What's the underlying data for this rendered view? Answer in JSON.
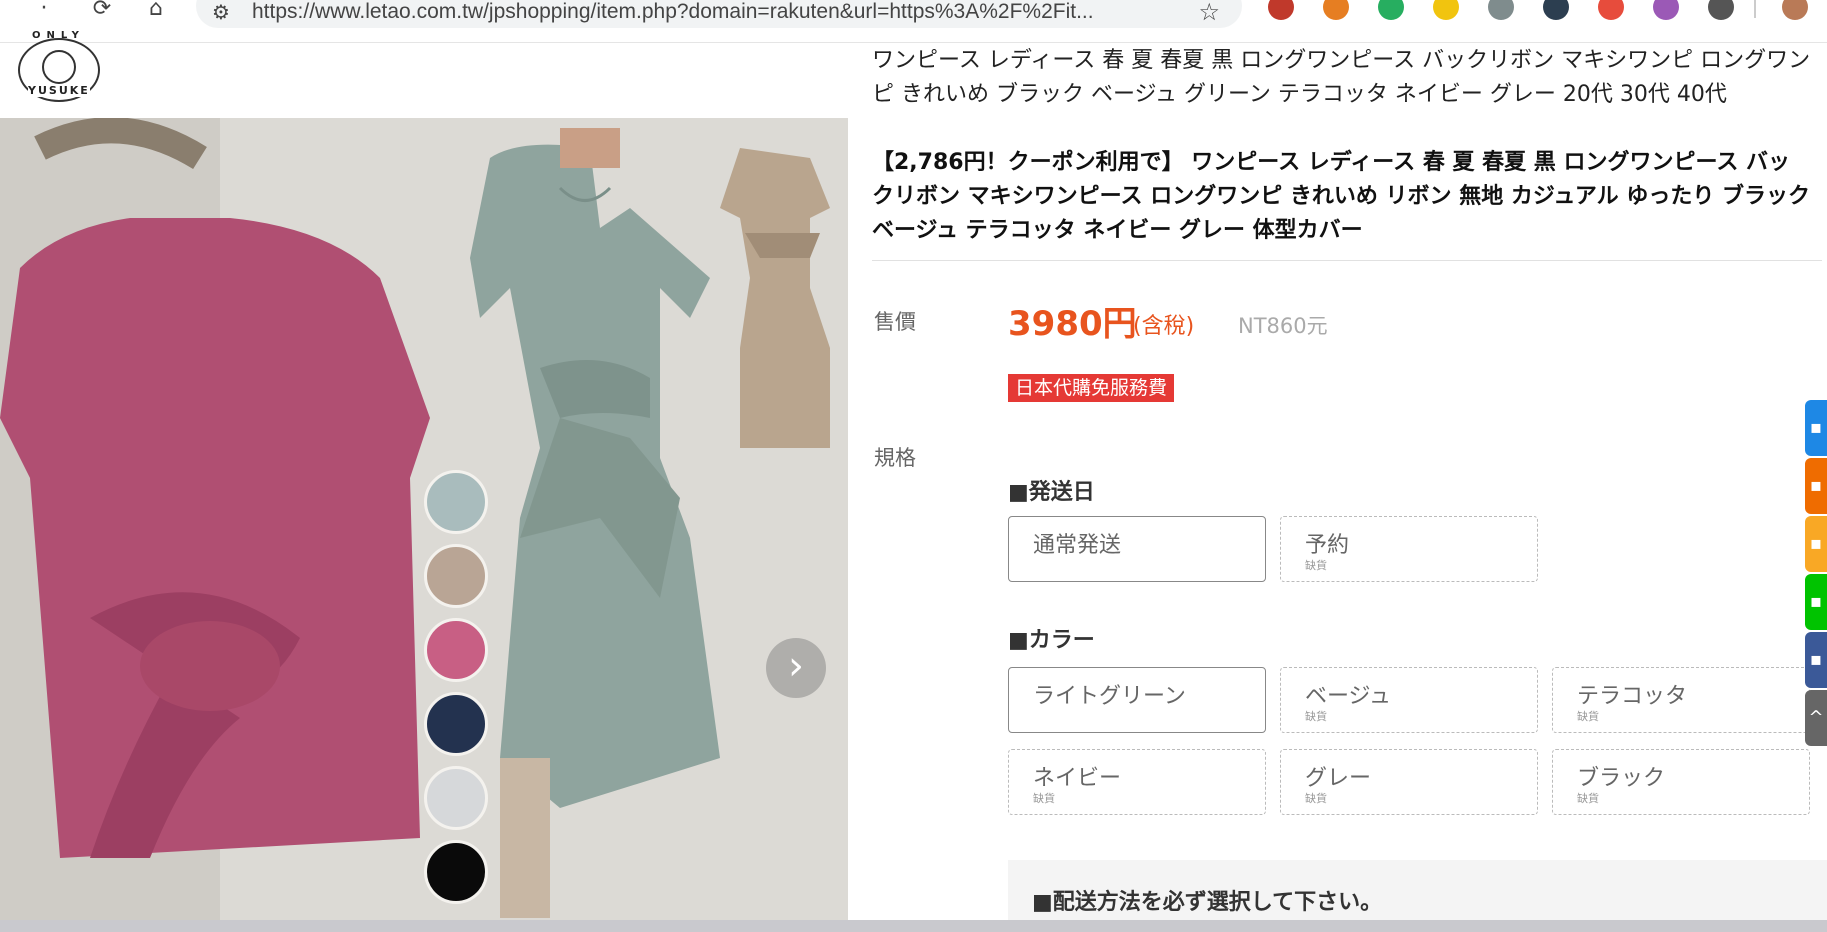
{
  "browser": {
    "url": "https://www.letao.com.tw/jpshopping/item.php?domain=rakuten&url=https%3A%2F%2Fit...",
    "ext_colors": [
      "#c0392b",
      "#e67e22",
      "#27ae60",
      "#f1c40f",
      "#7f8c8d",
      "#2c3e50",
      "#e74c3c",
      "#9b59b6",
      "#555555"
    ]
  },
  "logo": {
    "top_text": "ONLY",
    "bottom_text": "YUSUKE"
  },
  "product": {
    "title": "ワンピース レディース 春 夏 春夏 黒 ロングワンピース バックリボン マキシワンピ ロングワンピ きれいめ ブラック ベージュ グリーン テラコッタ ネイビー グレー 20代 30代 40代",
    "subtitle": "【2,786円！クーポン利用で】 ワンピース レディース 春 夏 春夏 黒 ロングワンピース バックリボン マキシワンピース ロングワンピ きれいめ リボン 無地 カジュアル ゆったり ブラック ベージュ テラコッタ ネイビー グレー 体型カバー",
    "price_label": "售價",
    "price": "3980円",
    "tax_note": "(含稅)",
    "price_nt": "NT860元",
    "badge": "日本代購免服務費",
    "spec_label": "規格"
  },
  "swatch_colors": [
    "#a9bcbd",
    "#b9a595",
    "#c85f84",
    "#23324f",
    "#d6d8da",
    "#0a0a0a"
  ],
  "shipping": {
    "title": "■発送日",
    "options": [
      {
        "name": "通常発送",
        "status": "",
        "selected": true
      },
      {
        "name": "予約",
        "status": "缺貨",
        "selected": false
      }
    ]
  },
  "colors": {
    "title": "■カラー",
    "options": [
      {
        "name": "ライトグリーン",
        "status": "",
        "selected": true
      },
      {
        "name": "ベージュ",
        "status": "缺貨",
        "selected": false
      },
      {
        "name": "テラコッタ",
        "status": "缺貨",
        "selected": false
      },
      {
        "name": "ネイビー",
        "status": "缺貨",
        "selected": false
      },
      {
        "name": "グレー",
        "status": "缺貨",
        "selected": false
      },
      {
        "name": "ブラック",
        "status": "缺貨",
        "selected": false
      }
    ]
  },
  "delivery_notice": "■配送方法を必ず選択して下さい。",
  "side_buttons": [
    {
      "icon": "gift-icon",
      "color": "#1e88e5"
    },
    {
      "icon": "coupon-icon",
      "color": "#ef6c00"
    },
    {
      "icon": "book-icon",
      "color": "#f9a825"
    },
    {
      "icon": "line-icon",
      "color": "#00c300"
    },
    {
      "icon": "facebook-icon",
      "color": "#3b5998"
    },
    {
      "icon": "scroll-top-icon",
      "color": "#666666"
    }
  ]
}
